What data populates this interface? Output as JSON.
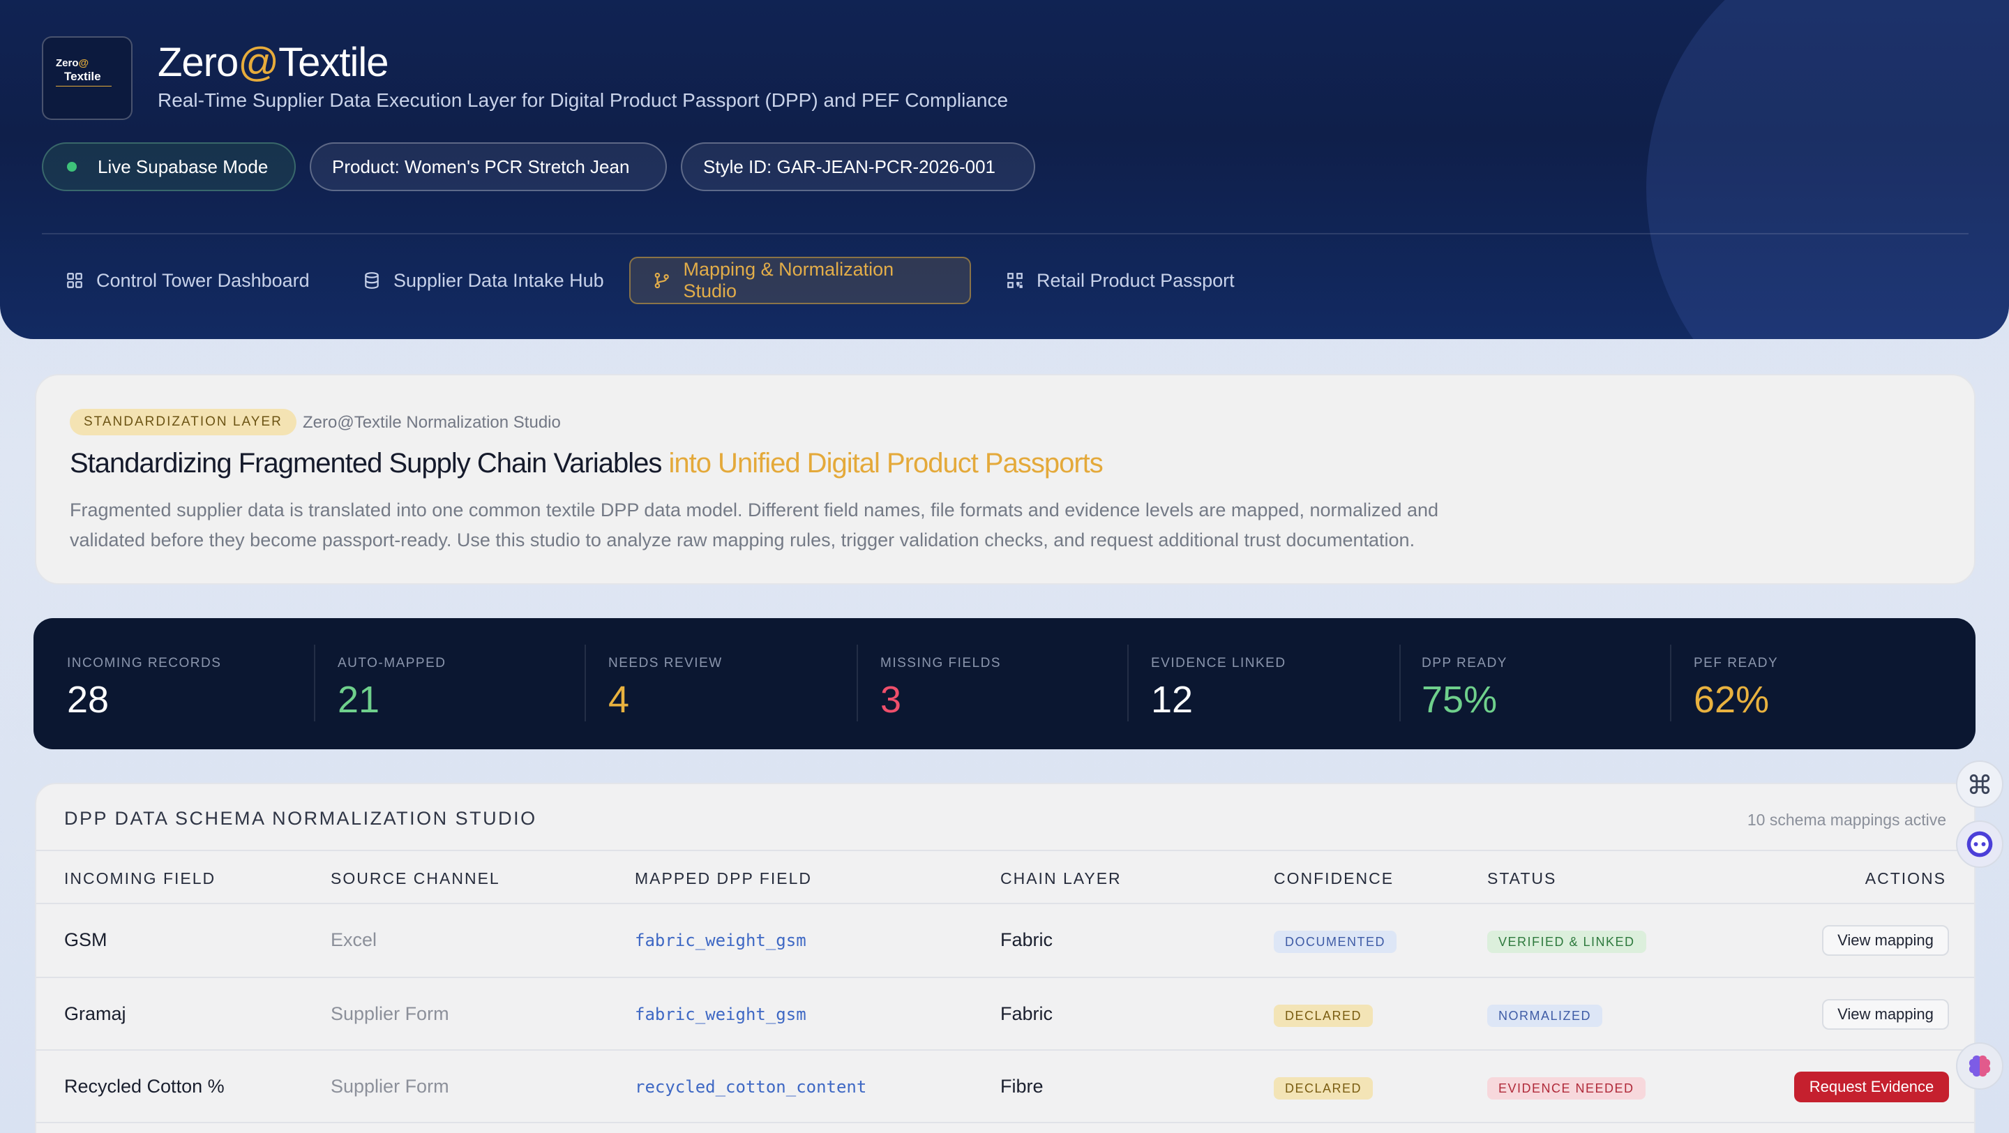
{
  "header": {
    "logo": {
      "line1": "Zero",
      "line1_at": "@",
      "line2": "Textile"
    },
    "title_main": "Zero",
    "title_at": "@",
    "title_rest": "Textile",
    "subtitle": "Real-Time Supplier Data Execution Layer for Digital Product Passport (DPP) and PEF Compliance",
    "pills": {
      "live": "Live Supabase Mode",
      "product": "Product: Women's PCR Stretch Jean",
      "style": "Style ID: GAR-JEAN-PCR-2026-001"
    },
    "nav": [
      {
        "label": "Control Tower Dashboard",
        "icon": "grid-icon",
        "active": false
      },
      {
        "label": "Supplier Data Intake Hub",
        "icon": "database-icon",
        "active": false
      },
      {
        "label": "Mapping & Normalization Studio",
        "icon": "git-branch-icon",
        "active": true
      },
      {
        "label": "Retail Product Passport",
        "icon": "qr-code-icon",
        "active": false
      }
    ]
  },
  "intro": {
    "badge": "STANDARDIZATION LAYER",
    "studio_name": "Zero@Textile Normalization Studio",
    "heading_main": "Standardizing Fragmented Supply Chain Variables ",
    "heading_highlight": "into Unified Digital Product Passports",
    "description": "Fragmented supplier data is translated into one common textile DPP data model. Different field names, file formats and evidence levels are mapped, normalized and validated before they become passport-ready. Use this studio to analyze raw mapping rules, trigger validation checks, and request additional trust documentation."
  },
  "stats": [
    {
      "label": "INCOMING RECORDS",
      "value": "28",
      "color": "#ffffff"
    },
    {
      "label": "AUTO-MAPPED",
      "value": "21",
      "color": "#6fd08c"
    },
    {
      "label": "NEEDS REVIEW",
      "value": "4",
      "color": "#e9b23f"
    },
    {
      "label": "MISSING FIELDS",
      "value": "3",
      "color": "#ef4f6b"
    },
    {
      "label": "EVIDENCE LINKED",
      "value": "12",
      "color": "#ffffff"
    },
    {
      "label": "DPP READY",
      "value": "75%",
      "color": "#6fd08c"
    },
    {
      "label": "PEF READY",
      "value": "62%",
      "color": "#e9b23f"
    }
  ],
  "table": {
    "title": "DPP DATA SCHEMA NORMALIZATION STUDIO",
    "meta": "10 schema mappings active",
    "columns": [
      "INCOMING FIELD",
      "SOURCE CHANNEL",
      "MAPPED DPP FIELD",
      "CHAIN LAYER",
      "CONFIDENCE",
      "STATUS",
      "ACTIONS"
    ],
    "rows": [
      {
        "field": "GSM",
        "source": "Excel",
        "mapped": "fabric_weight_gsm",
        "layer": "Fabric",
        "confidence": "DOCUMENTED",
        "status": "VERIFIED & LINKED",
        "action": "View mapping"
      },
      {
        "field": "Gramaj",
        "source": "Supplier Form",
        "mapped": "fabric_weight_gsm",
        "layer": "Fabric",
        "confidence": "DECLARED",
        "status": "NORMALIZED",
        "action": "View mapping"
      },
      {
        "field": "Recycled Cotton %",
        "source": "Supplier Form",
        "mapped": "recycled_cotton_content",
        "layer": "Fibre",
        "confidence": "DECLARED",
        "status": "EVIDENCE NEEDED",
        "action": "Request Evidence"
      }
    ]
  },
  "colors": {
    "header_bg": "#0f1f4a",
    "accent_gold": "#e4a93a",
    "stats_bg": "#0b1731",
    "danger": "#c5202e"
  }
}
